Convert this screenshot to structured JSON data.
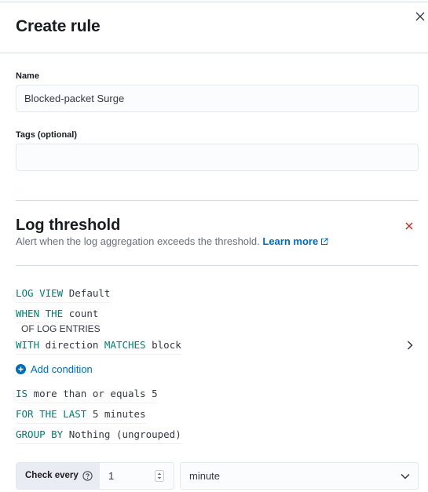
{
  "flyout": {
    "title": "Create rule",
    "close_icon": "close-icon"
  },
  "form": {
    "name_label": "Name",
    "name_value": "Blocked-packet Surge",
    "tags_label": "Tags (optional)",
    "tags_value": ""
  },
  "rule_type": {
    "title": "Log threshold",
    "description": "Alert when the log aggregation exceeds the threshold.",
    "learn_more": "Learn more",
    "external_icon": "external-link-icon",
    "remove_icon": "cross-icon"
  },
  "expressions": {
    "log_view": {
      "keyword": "LOG VIEW",
      "value": "Default"
    },
    "when": {
      "keyword": "WHEN THE",
      "value": "count"
    },
    "of_log_entries": "OF LOG ENTRIES",
    "with": {
      "keyword": "WITH",
      "field": "direction",
      "operator": "MATCHES",
      "value": "block"
    },
    "add_condition": "Add condition",
    "is": {
      "keyword": "IS",
      "value": "more than or equals 5"
    },
    "for_the_last": {
      "keyword": "FOR THE LAST",
      "value": "5 minutes"
    },
    "group_by": {
      "keyword": "GROUP BY",
      "value": "Nothing (ungrouped)"
    }
  },
  "schedule": {
    "check_every_label": "Check every",
    "interval_value": "1",
    "unit_value": "minute"
  },
  "colors": {
    "accent": "#006bb8",
    "keyword": "#017d73",
    "danger": "#bd271e",
    "border": "#d3dae6"
  }
}
